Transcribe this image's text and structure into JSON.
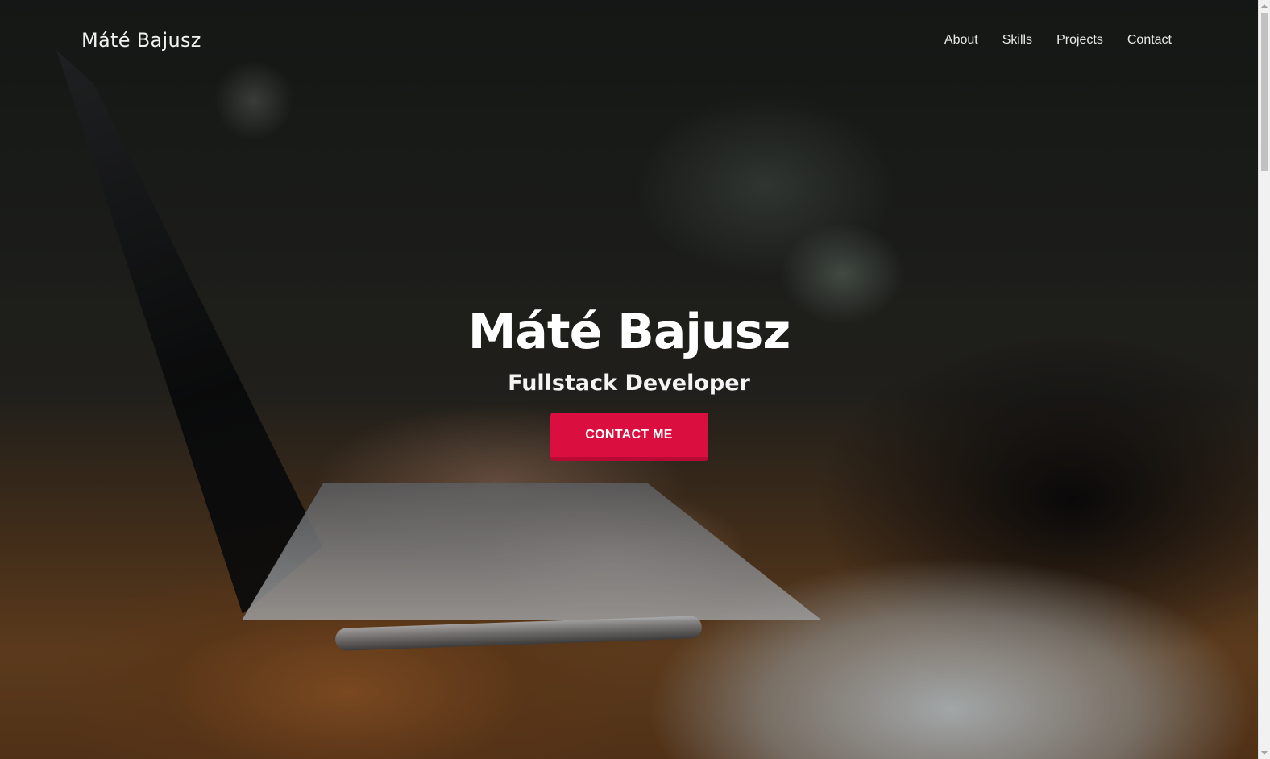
{
  "navbar": {
    "brand": "Máté Bajusz",
    "links": [
      "About",
      "Skills",
      "Projects",
      "Contact"
    ]
  },
  "hero": {
    "title": "Máté Bajusz",
    "subtitle": "Fullstack Developer",
    "cta_label": "CONTACT ME",
    "background_image": "laptop-typing-photo"
  },
  "colors": {
    "accent": "#da0f3f",
    "text": "#ffffff"
  }
}
